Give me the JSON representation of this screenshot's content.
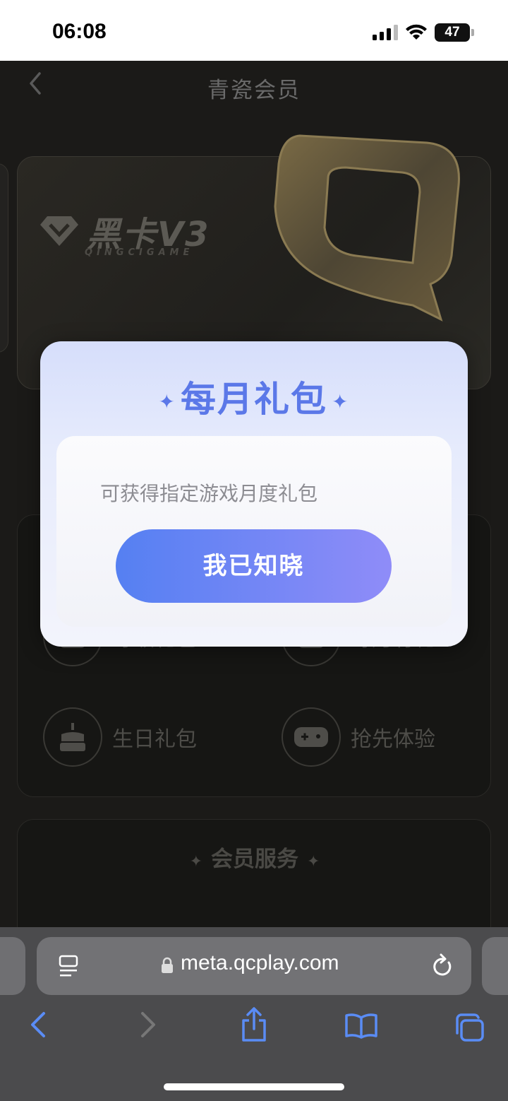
{
  "status_bar": {
    "time": "06:08",
    "battery": "47"
  },
  "header": {
    "title": "青瓷会员"
  },
  "vip_card": {
    "title": "黑卡V3",
    "subtitle": "QINGCIGAME"
  },
  "benefits": {
    "items": [
      {
        "label": "等级礼包",
        "icon": "heart-box-icon"
      },
      {
        "label": "每月有礼",
        "icon": "sparkle-box-icon"
      },
      {
        "label": "生日礼包",
        "icon": "cake-icon"
      },
      {
        "label": "抢先体验",
        "icon": "gamepad-icon"
      }
    ]
  },
  "services": {
    "title": "会员服务"
  },
  "modal": {
    "title": "每月礼包",
    "description": "可获得指定游戏月度礼包",
    "confirm_label": "我已知晓"
  },
  "browser": {
    "url": "meta.qcplay.com"
  },
  "colors": {
    "accent": "#5b78e8",
    "button_start": "#5580f2",
    "button_end": "#8f8cf8"
  }
}
